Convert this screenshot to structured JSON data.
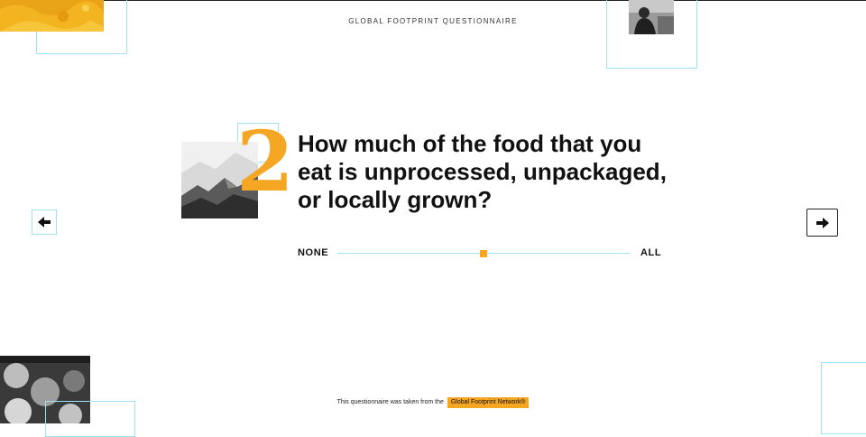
{
  "header": {
    "title": "GLOBAL FOOTPRINT QUESTIONNAIRE"
  },
  "question": {
    "number": "2",
    "text": "How much of the food that you eat is unprocessed, unpackaged, or locally grown?"
  },
  "slider": {
    "min_label": "NONE",
    "max_label": "ALL",
    "value_fraction": 0.5
  },
  "navigation": {
    "prev_icon": "arrow-left-icon",
    "next_icon": "arrow-right-icon"
  },
  "footer": {
    "text": "This questionnaire was taken from the",
    "link_label": "Global Footprint Network®"
  },
  "colors": {
    "accent": "#f5a623",
    "frame": "#9ee3ef",
    "text": "#111111"
  }
}
